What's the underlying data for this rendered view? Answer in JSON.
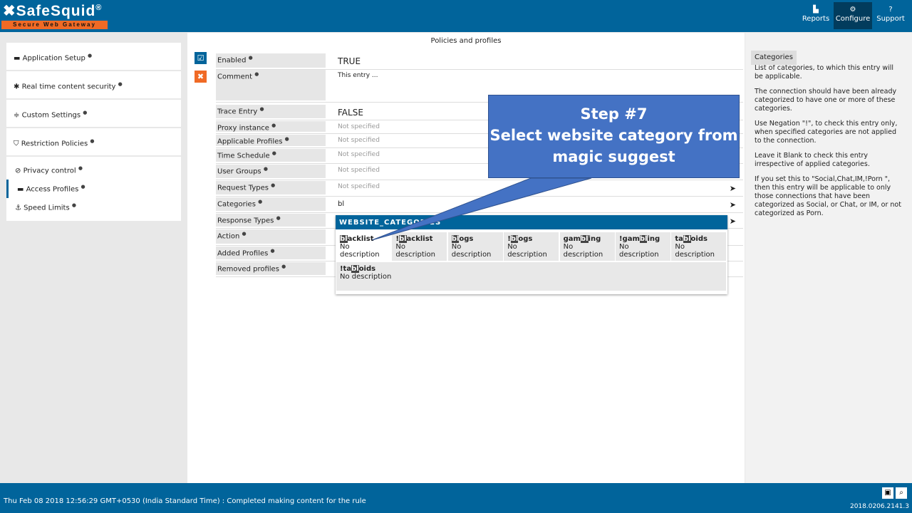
{
  "header": {
    "logo": "SafeSquid",
    "logo_mark": "®",
    "tagline": "Secure Web Gateway",
    "nav": [
      {
        "label": "Reports",
        "icon": "chart-icon"
      },
      {
        "label": "Configure",
        "icon": "cogs-icon",
        "active": true
      },
      {
        "label": "Support",
        "icon": "help-icon"
      }
    ]
  },
  "sidebar": {
    "sections": [
      {
        "label": "Application Setup",
        "icon": "briefcase-icon"
      },
      {
        "label": "Real time content security",
        "icon": "bug-icon"
      },
      {
        "label": "Custom Settings",
        "icon": "sliders-icon"
      },
      {
        "label": "Restriction Policies",
        "icon": "shield-icon"
      }
    ],
    "items": [
      {
        "label": "Privacy control",
        "icon": "ban-icon"
      },
      {
        "label": "Access Profiles",
        "icon": "briefcase-icon",
        "selected": true
      },
      {
        "label": "Speed Limits",
        "icon": "anchor-icon"
      }
    ]
  },
  "main": {
    "title": "Policies and profiles",
    "rows": [
      {
        "label": "Enabled",
        "value": "TRUE"
      },
      {
        "label": "Comment",
        "value": "This entry ..."
      },
      {
        "label": "Trace Entry",
        "value": "FALSE"
      },
      {
        "label": "Proxy instance",
        "value": "Not specified"
      },
      {
        "label": "Applicable Profiles",
        "value": "Not specified"
      },
      {
        "label": "Time Schedule",
        "value": "Not specified"
      },
      {
        "label": "User Groups",
        "value": "Not specified"
      },
      {
        "label": "Request Types",
        "value": "Not specified"
      },
      {
        "label": "Categories",
        "value": "bl"
      },
      {
        "label": "Response Types",
        "value": ""
      },
      {
        "label": "Action",
        "value": ""
      },
      {
        "label": "Added Profiles",
        "value": ""
      },
      {
        "label": "Removed profiles",
        "value": ""
      }
    ]
  },
  "suggest": {
    "header": "WEBSITE_CATEGORIES",
    "no_desc": "No description",
    "items": [
      {
        "pre": "",
        "m": "bl",
        "post": "acklist"
      },
      {
        "pre": "!",
        "m": "bl",
        "post": "acklist"
      },
      {
        "pre": "",
        "m": "bl",
        "post": "ogs"
      },
      {
        "pre": "!",
        "m": "bl",
        "post": "ogs"
      },
      {
        "pre": "gam",
        "m": "bl",
        "post": "ing"
      },
      {
        "pre": "!gam",
        "m": "bl",
        "post": "ing"
      },
      {
        "pre": "ta",
        "m": "bl",
        "post": "oids"
      },
      {
        "pre": "!ta",
        "m": "bl",
        "post": "oids"
      }
    ]
  },
  "help": {
    "title": "Categories",
    "paragraphs": [
      "List of categories, to which this entry will be applicable.",
      "The connection should have been already categorized to have one or more of these categories.",
      "Use Negation \"!\", to check this entry only, when specified categories are not applied to the connection.",
      "Leave it Blank to check this entry irrespective of applied categories.",
      "If you set this to \"Social,Chat,IM,!Porn \", then this entry will be applicable to only those connections that have been categorized as Social, or Chat, or IM, or not categorized as Porn."
    ]
  },
  "callout": {
    "line1": "Step #7",
    "line2": "Select website category from magic suggest"
  },
  "footer": {
    "status": "Thu Feb 08 2018 12:56:29 GMT+0530 (India Standard Time) : Completed making content for the rule",
    "version": "2018.0206.2141.3"
  },
  "colors": {
    "brand": "#01649b",
    "accent": "#f06a25",
    "callout": "#4472c4"
  }
}
